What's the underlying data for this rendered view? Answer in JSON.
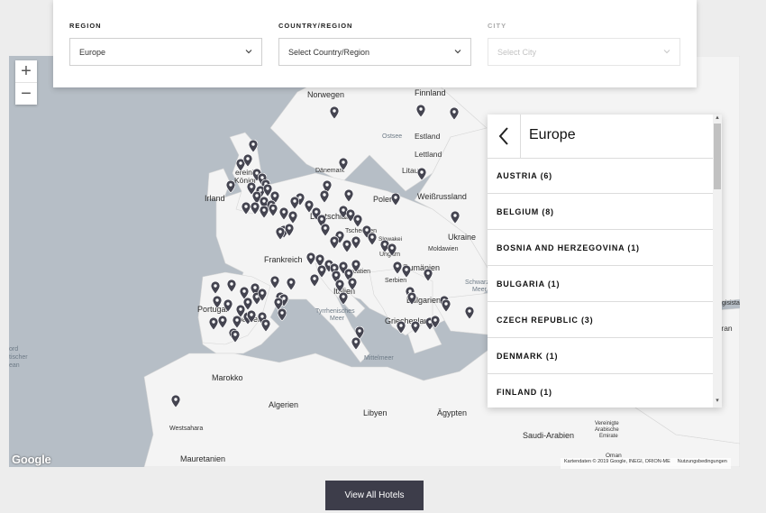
{
  "filters": {
    "region": {
      "label": "REGION",
      "value": "Europe"
    },
    "country": {
      "label": "COUNTRY/REGION",
      "value": "Select Country/Region"
    },
    "city": {
      "label": "CITY",
      "placeholder": "Select City"
    }
  },
  "map": {
    "labels": {
      "norwegen": "Norwegen",
      "finnland": "Finnland",
      "estland": "Estland",
      "lettland": "Lettland",
      "litau": "Litau",
      "daenemark": "Dänemark",
      "vereinigtes": "ereinig",
      "koenig": "Königr",
      "irland": "Irland",
      "polen": "Polen",
      "weissrussland": "Weißrussland",
      "deutschland": "Deutschland",
      "tschechien": "Tschechien",
      "slowakei": "Slowakei",
      "ukraine": "Ukraine",
      "moldawien": "Moldawien",
      "frankreich": "Frankreich",
      "ungarn": "Ungarn",
      "rumaenien": "Rumänien",
      "kroatien": "Kroatien",
      "serbien": "Serbien",
      "italien": "Italien",
      "bulgarien": "Bulgarien",
      "portugal": "Portugal",
      "spanien": "Spanien",
      "griechenland": "Griechenland",
      "marokko": "Marokko",
      "algerien": "Algerien",
      "libyen": "Libyen",
      "aegypten": "Ägypten",
      "saudi": "Saudi-Arabien",
      "westsahara": "Westsahara",
      "mauretanien": "Mauretanien",
      "vae_1": "Vereinigte",
      "vae_2": "Arabische",
      "vae_3": "Emirate",
      "oman": "Oman",
      "georgia_partial": "gisista",
      "iran_partial": "Iran"
    },
    "seas": {
      "ostsee": "Ostsee",
      "tyrrhenisches_1": "Tyrrhenisches",
      "tyrrhenisches_2": "Meer",
      "schwarzes_1": "Schwarzes",
      "schwarzes_2": "Meer",
      "mittelmeer": "Mittelmeer",
      "atlantic_1": "ord",
      "atlantic_2": "tischer",
      "atlantic_3": "ean"
    },
    "zoom_in": "+",
    "zoom_out": "−",
    "logo": "Google",
    "attribution": {
      "data": "Kartendaten © 2019 Google, INEGI, ORION-ME",
      "terms": "Nutzungsbedingungen"
    },
    "pin_color": "#444450"
  },
  "panel": {
    "title": "Europe",
    "items": [
      "AUSTRIA (6)",
      "BELGIUM (8)",
      "BOSNIA AND HERZEGOVINA (1)",
      "BULGARIA (1)",
      "CZECH REPUBLIC (3)",
      "DENMARK (1)",
      "FINLAND (1)"
    ]
  },
  "button": {
    "label": "View All Hotels"
  }
}
